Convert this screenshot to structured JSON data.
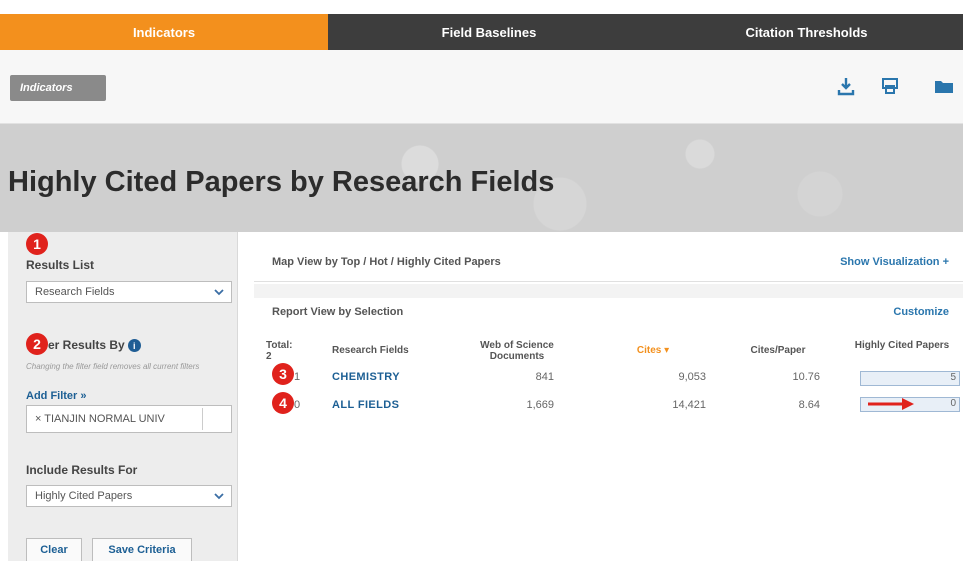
{
  "nav": {
    "tabs": [
      "Indicators",
      "Field Baselines",
      "Citation Thresholds"
    ]
  },
  "toolbar": {
    "breadcrumb": "Indicators",
    "icons": [
      "download-icon",
      "print-icon",
      "folder-icon"
    ]
  },
  "page": {
    "title": "Highly Cited Papers by Research Fields"
  },
  "sidebar": {
    "step1": "1",
    "results_list_label": "Results List",
    "results_list_value": "Research Fields",
    "step2": "2",
    "filter_label": "er Results By",
    "info": "i",
    "filter_hint": "Changing the filter field removes all current filters",
    "add_filter": "Add Filter »",
    "filter_chip": "× TIANJIN NORMAL UNIV",
    "include_label": "Include Results For",
    "include_value": "Highly Cited Papers",
    "clear_button": "Clear",
    "save_button": "Save Criteria"
  },
  "main": {
    "map_view_label": "Map View by Top / Hot / Highly Cited Papers",
    "show_visualization": "Show Visualization +",
    "report_view_label": "Report View by Selection",
    "customize": "Customize",
    "columns": {
      "total": "Total:",
      "total_value": "2",
      "fields": "Research Fields",
      "docs": "Web of Science Documents",
      "cites": "Cites ▾",
      "cites_per_paper": "Cites/Paper",
      "hcp": "Highly Cited Papers"
    },
    "step3": "3",
    "step4": "4",
    "rows": [
      {
        "index": "1",
        "field": "CHEMISTRY",
        "docs": "841",
        "cites": "9,053",
        "cpp": "10.76",
        "hcp": "5"
      },
      {
        "index": "0",
        "field": "ALL FIELDS",
        "docs": "1,669",
        "cites": "14,421",
        "cpp": "8.64",
        "hcp": "0"
      }
    ]
  },
  "colors": {
    "accent": "#f3901d",
    "marker": "#e0221c",
    "link": "#1c5f94"
  }
}
